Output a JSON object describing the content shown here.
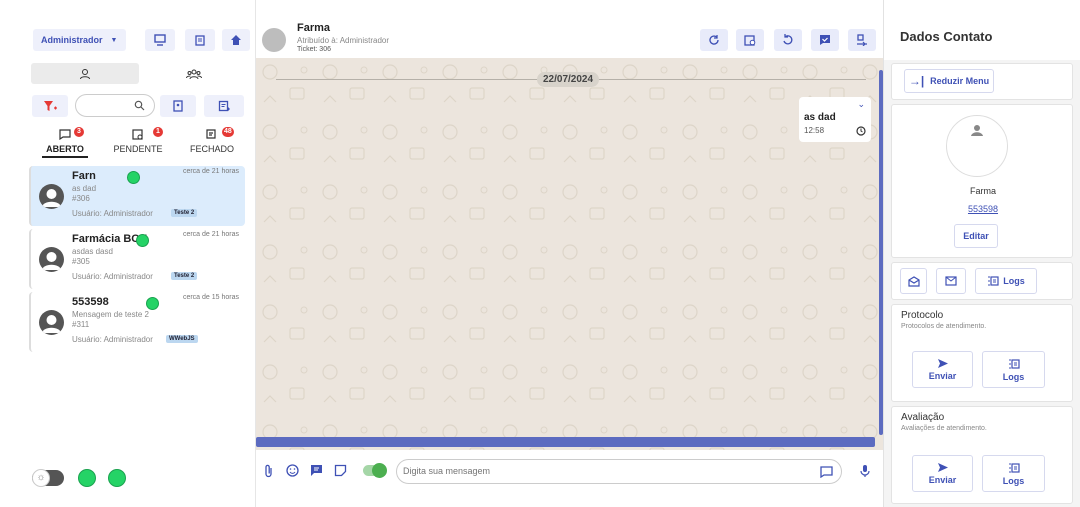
{
  "left": {
    "user_dropdown": "Administrador",
    "tabs": [
      {
        "label": "ABERTO",
        "count": "3"
      },
      {
        "label": "PENDENTE",
        "count": "1"
      },
      {
        "label": "FECHADO",
        "count": "48"
      }
    ],
    "search_placeholder": "",
    "tickets": [
      {
        "name": "Farn",
        "msg1": "as dad",
        "msg2": "#306",
        "time": "cerca de 21 horas",
        "user": "Usuário: Administrador",
        "tag": "Teste 2"
      },
      {
        "name": "Farmácia BOT",
        "msg1": "asdas dasd",
        "msg2": "#305",
        "time": "cerca de 21 horas",
        "user": "Usuário: Administrador",
        "tag": "Teste 2"
      },
      {
        "name": "553598",
        "msg1": "Mensagem de teste 2",
        "msg2": "#311",
        "time": "cerca de 15 horas",
        "user": "Usuário: Administrador",
        "tag": "WWebJS"
      }
    ]
  },
  "chat": {
    "contact_name": "Farma",
    "assigned": "Atribuído à: Administrador",
    "ticket": "Ticket: 306",
    "date_chip": "22/07/2024",
    "message": {
      "text": "as dad",
      "time": "12:58"
    },
    "input_placeholder": "Digita sua mensagem"
  },
  "right": {
    "title": "Dados Contato",
    "reduce_menu": "Reduzir Menu",
    "contact_name": "Farma",
    "contact_number": "553598",
    "edit": "Editar",
    "logs": "Logs",
    "protocol_title": "Protocolo",
    "protocol_sub": "Protocolos de atendimento.",
    "send": "Enviar",
    "eval_title": "Avaliação",
    "eval_sub": "Avaliações de atendimento."
  }
}
